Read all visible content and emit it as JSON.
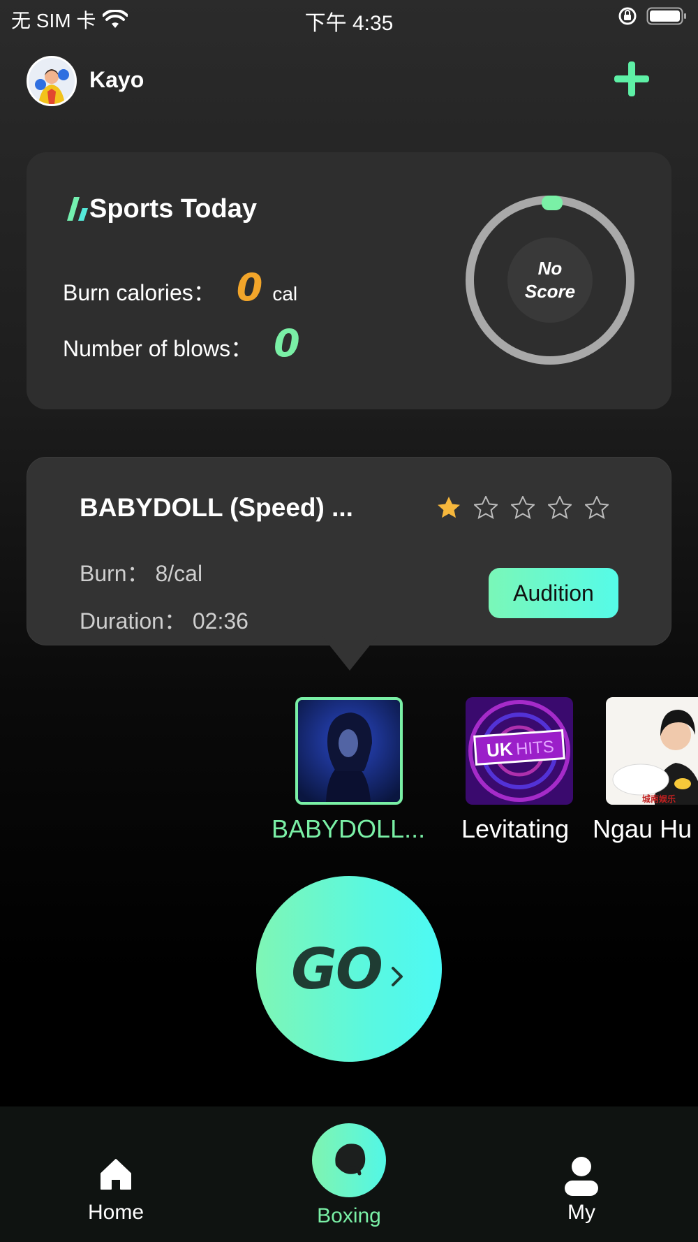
{
  "status_bar": {
    "carrier": "无 SIM 卡",
    "time": "下午 4:35",
    "icons": [
      "wifi-icon",
      "rotation-lock-icon",
      "battery-icon"
    ]
  },
  "header": {
    "username": "Kayo",
    "add_icon": "plus-icon"
  },
  "sports_today": {
    "title": "Sports Today",
    "calories_label": "Burn calories：",
    "calories_value": "0",
    "calories_unit": "cal",
    "blows_label": "Number of blows：",
    "blows_value": "0",
    "score_line1": "No",
    "score_line2": "Score"
  },
  "current_song": {
    "title": "BABYDOLL (Speed) ...",
    "rating": 1,
    "rating_max": 5,
    "burn": "Burn：  8/cal",
    "duration": "Duration：  02:36",
    "audition_label": "Audition"
  },
  "songs": [
    {
      "label": "BABYDOLL...",
      "selected": true
    },
    {
      "label": "Levitating",
      "selected": false
    },
    {
      "label": "Ngau Hu",
      "selected": false
    }
  ],
  "thumb_texts": {
    "uk": "UK",
    "hits": "HITS",
    "watermark": "城南娱乐"
  },
  "go_label": "GO",
  "tabs": [
    {
      "label": "Home",
      "icon": "home-icon",
      "active": false
    },
    {
      "label": "Boxing",
      "icon": "boxing-glove-icon",
      "active": true
    },
    {
      "label": "My",
      "icon": "person-icon",
      "active": false
    }
  ],
  "colors": {
    "accent_green": "#7af0a6",
    "accent_cyan": "#4df9f4",
    "calories_orange": "#f2a52a",
    "star_gold": "#f6b73c"
  }
}
